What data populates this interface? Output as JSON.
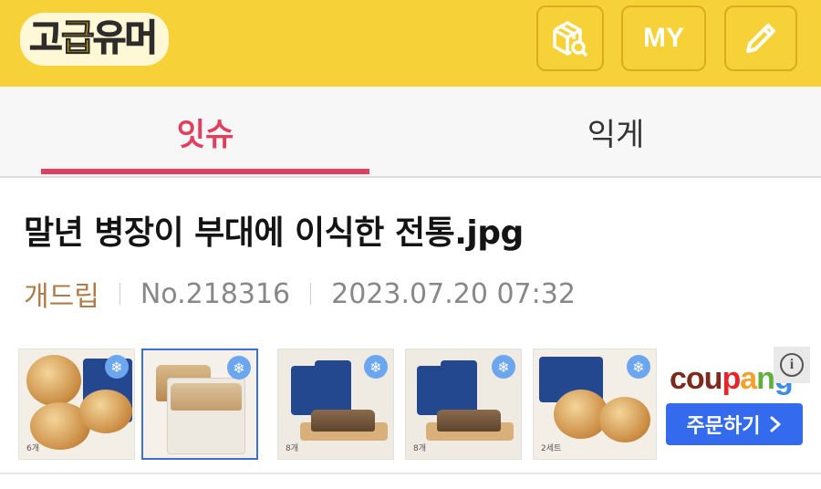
{
  "header": {
    "logo_text": "고급유머",
    "logo_accent": "급",
    "my_label": "MY",
    "icons": [
      "package-search-icon",
      "pencil-icon"
    ],
    "brand_color": "#f6d238"
  },
  "tabs": [
    {
      "label": "잇슈",
      "active": true
    },
    {
      "label": "익게",
      "active": false
    }
  ],
  "post": {
    "title": "말년 병장이 부대에 이식한 전통.jpg",
    "category": "개드립",
    "number": "No.218316",
    "datetime": "2023.07.20 07:32"
  },
  "ad": {
    "brand": [
      "cou",
      "p",
      "a",
      "n",
      "g"
    ],
    "button_label": "주문하기",
    "info_symbol": "i",
    "products": [
      {
        "count": "6개"
      },
      {
        "count": "",
        "selected": true
      },
      {
        "count": "8개"
      },
      {
        "count": "8개"
      },
      {
        "count": "2세트"
      }
    ]
  },
  "colors": {
    "accent": "#e0405e",
    "category": "#b07a4a",
    "buy_button": "#346aed"
  }
}
